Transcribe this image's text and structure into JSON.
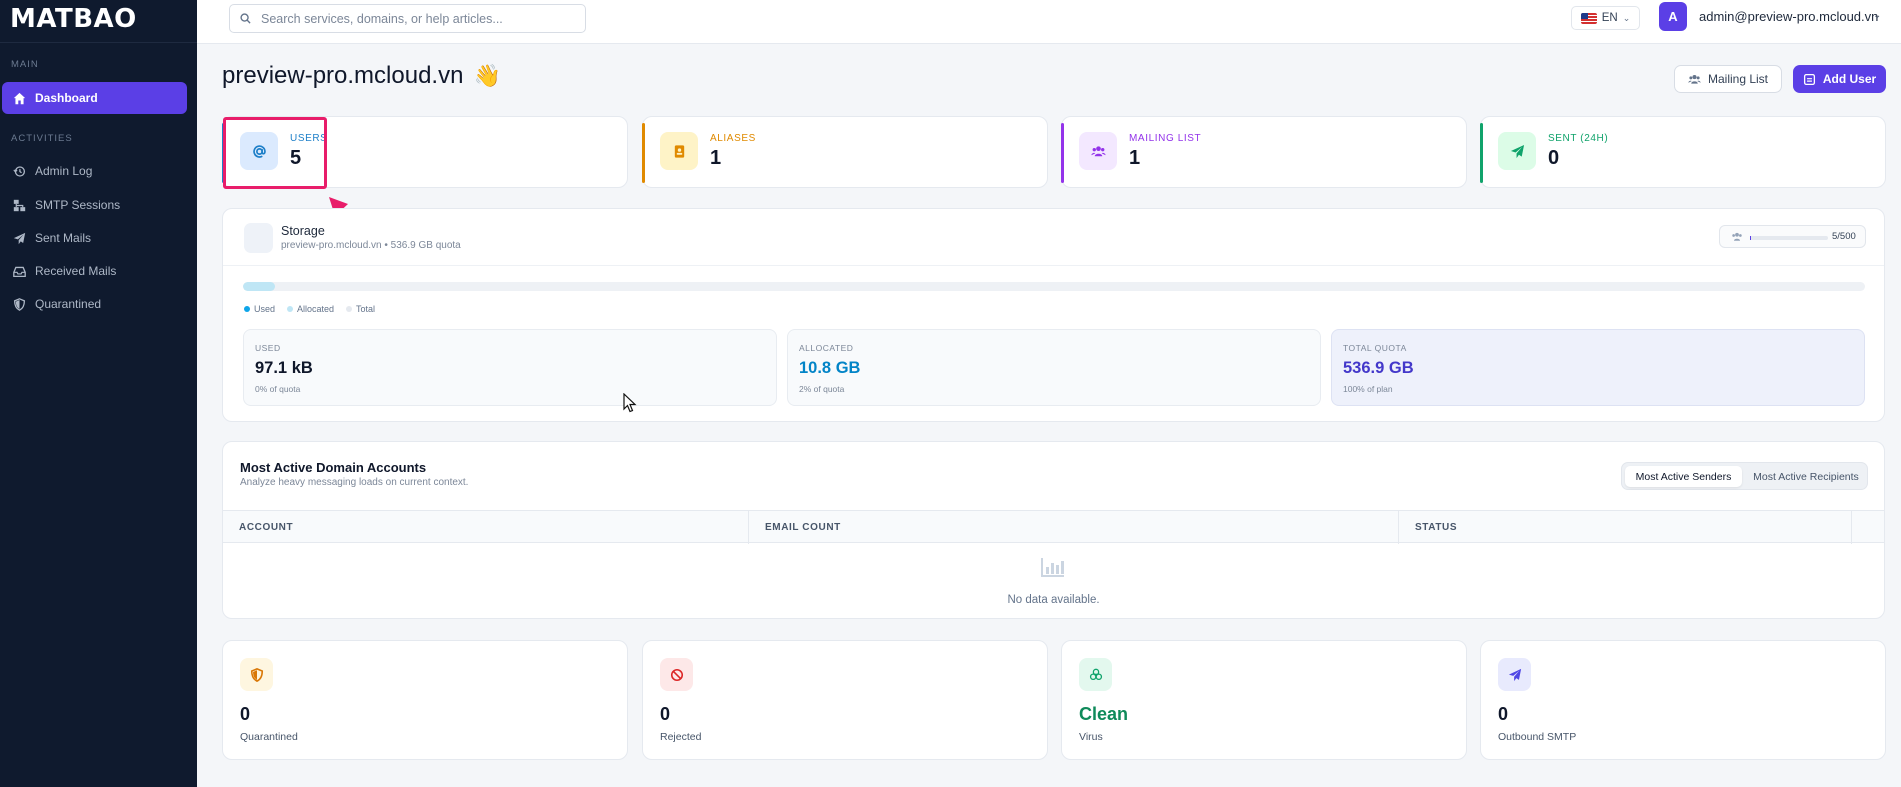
{
  "brand": {
    "logo_text": "MATBAO"
  },
  "sidebar": {
    "sections": {
      "main": "MAIN",
      "activities": "ACTIVITIES"
    },
    "items": [
      {
        "label": "Dashboard",
        "icon": "home-icon",
        "active": true
      },
      {
        "label": "Admin Log",
        "icon": "history-icon"
      },
      {
        "label": "SMTP Sessions",
        "icon": "sitemap-icon"
      },
      {
        "label": "Sent Mails",
        "icon": "paper-plane-icon"
      },
      {
        "label": "Received Mails",
        "icon": "inbox-icon"
      },
      {
        "label": "Quarantined",
        "icon": "shield-icon"
      }
    ]
  },
  "topbar": {
    "search_placeholder": "Search services, domains, or help articles...",
    "language": "EN",
    "avatar_initial": "A",
    "user_email": "admin@preview-pro.mcloud.vn"
  },
  "page": {
    "title": "preview-pro.mcloud.vn",
    "title_emoji": "👋",
    "mailing_list_button": "Mailing List",
    "add_user_button": "Add User"
  },
  "stats": [
    {
      "label": "USERS",
      "value": "5",
      "icon": "at-icon",
      "color": "#1d7fc8",
      "bg": "#dbeafe"
    },
    {
      "label": "ALIASES",
      "value": "1",
      "icon": "contact-book-icon",
      "color": "#e08a00",
      "bg": "#fef3c7"
    },
    {
      "label": "MAILING LIST",
      "value": "1",
      "icon": "users-icon",
      "color": "#9333ea",
      "bg": "#f3e8ff"
    },
    {
      "label": "SENT (24H)",
      "value": "0",
      "icon": "paper-plane-icon",
      "color": "#10a36b",
      "bg": "#dcfce7"
    }
  ],
  "storage": {
    "title": "Storage",
    "domain": "preview-pro.mcloud.vn",
    "quota_text": "536.9 GB quota",
    "users_count": "5/500",
    "legend": [
      "Used",
      "Allocated",
      "Total"
    ],
    "allocated_fraction": 0.02,
    "boxes": [
      {
        "label": "USED",
        "value": "97.1 kB",
        "sub": "0% of quota",
        "color": "#0f172a"
      },
      {
        "label": "ALLOCATED",
        "value": "10.8 GB",
        "sub": "2% of quota",
        "color": "#0284c7"
      },
      {
        "label": "TOTAL QUOTA",
        "value": "536.9 GB",
        "sub": "100% of plan",
        "color": "#4338ca"
      }
    ]
  },
  "accounts": {
    "title": "Most Active Domain Accounts",
    "subtitle": "Analyze heavy messaging loads on current context.",
    "tabs": [
      "Most Active Senders",
      "Most Active Recipients"
    ],
    "columns": [
      "ACCOUNT",
      "EMAIL COUNT",
      "STATUS"
    ],
    "empty_text": "No data available."
  },
  "summary": [
    {
      "value": "0",
      "label": "Quarantined",
      "icon": "shield-icon",
      "color": "#d97706",
      "bg": "#fef6e0",
      "value_color": "#0f172a"
    },
    {
      "value": "0",
      "label": "Rejected",
      "icon": "ban-icon",
      "color": "#dc2626",
      "bg": "#fde8e8",
      "value_color": "#0f172a"
    },
    {
      "value": "Clean",
      "label": "Virus",
      "icon": "biohazard-icon",
      "color": "#10a36b",
      "bg": "#e3f8ee",
      "value_color": "#0f8a5a"
    },
    {
      "value": "0",
      "label": "Outbound SMTP",
      "icon": "paper-plane-icon",
      "color": "#4f46e5",
      "bg": "#e8eafd",
      "value_color": "#0f172a"
    }
  ]
}
